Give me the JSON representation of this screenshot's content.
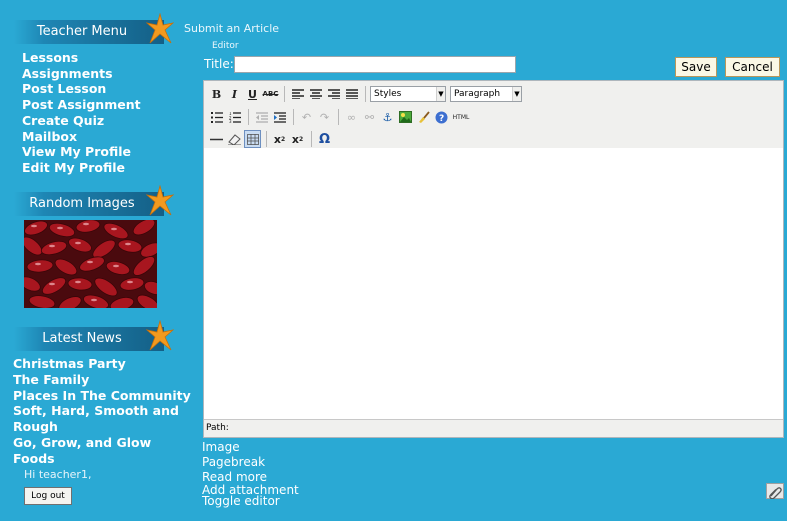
{
  "sidebar": {
    "teacher_menu_title": "Teacher Menu",
    "menu_items": [
      "Lessons",
      "Assignments",
      "Post Lesson",
      "Post Assignment",
      "Create Quiz",
      "Mailbox",
      "View My Profile",
      "Edit My Profile"
    ],
    "random_images_title": "Random Images",
    "latest_news_title": "Latest News",
    "news_items": [
      "Christmas Party",
      "The Family",
      "Places In The Community",
      "Soft, Hard, Smooth and Rough",
      "Go, Grow, and Glow Foods"
    ],
    "greeting": "Hi teacher1,",
    "logout_label": "Log out"
  },
  "main": {
    "page_title": "Submit an Article",
    "editor_label": "Editor",
    "title_label": "Title:",
    "title_value": "",
    "save_label": "Save",
    "cancel_label": "Cancel"
  },
  "editor": {
    "styles_select": "Styles",
    "format_select": "Paragraph",
    "path_label": "Path:",
    "html_button": "HTML"
  },
  "footer_links": [
    "Image",
    "Pagebreak",
    "Read more",
    "Add attachment",
    "Toggle editor"
  ],
  "colors": {
    "background": "#2aa9d4",
    "header_dark": "#145f86",
    "star": "#f29a1f"
  }
}
